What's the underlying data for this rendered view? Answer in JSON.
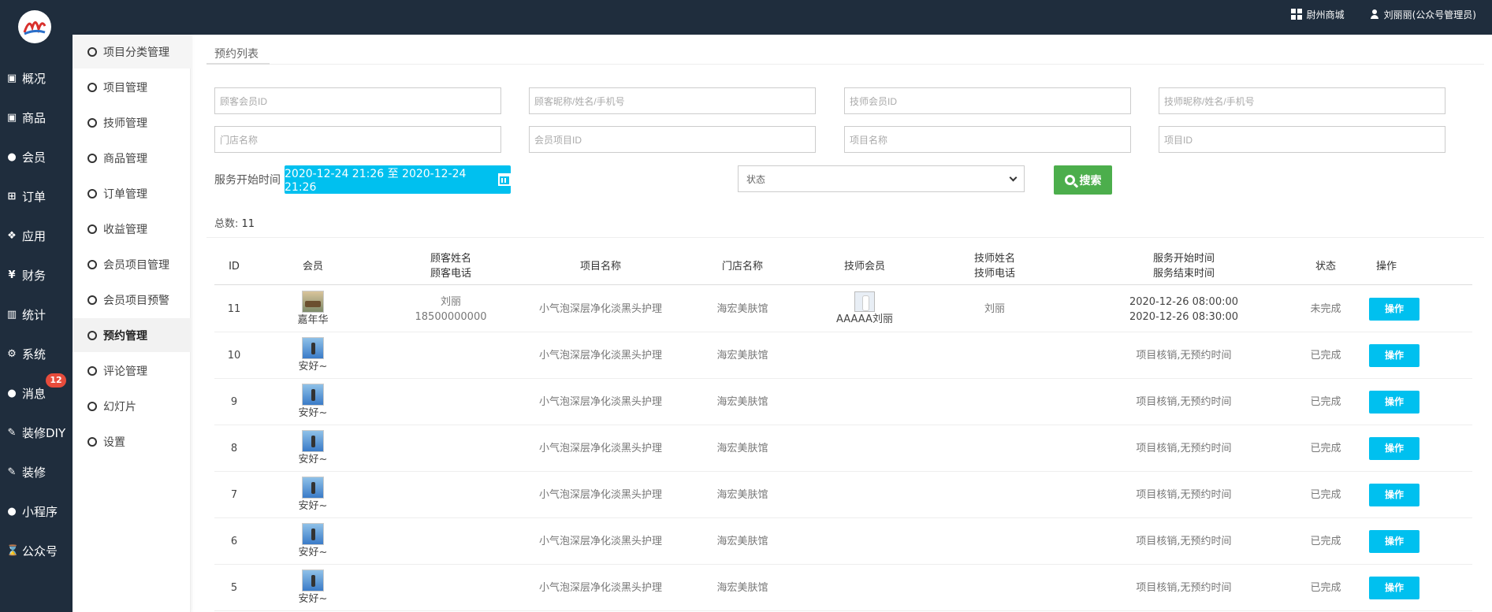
{
  "topbar": {
    "shop_label": "尉州商城",
    "user_label": "刘丽丽(公众号管理员)"
  },
  "sidebar": {
    "items": [
      {
        "label": "概况",
        "icon": "overview-icon",
        "glyph": "▣"
      },
      {
        "label": "商品",
        "icon": "goods-icon",
        "glyph": "▣"
      },
      {
        "label": "会员",
        "icon": "members-icon",
        "glyph": "●"
      },
      {
        "label": "订单",
        "icon": "cart-icon",
        "glyph": "⊞"
      },
      {
        "label": "应用",
        "icon": "apps-icon",
        "glyph": "❖"
      },
      {
        "label": "财务",
        "icon": "yen-icon",
        "glyph": "¥"
      },
      {
        "label": "统计",
        "icon": "chart-icon",
        "glyph": "▥"
      },
      {
        "label": "系统",
        "icon": "cogs-icon",
        "glyph": "⚙"
      },
      {
        "label": "消息",
        "icon": "comment-icon",
        "glyph": "●"
      },
      {
        "label": "装修DIY",
        "icon": "gavel-icon",
        "glyph": "✎"
      },
      {
        "label": "装修",
        "icon": "gavel-icon",
        "glyph": "✎"
      },
      {
        "label": "小程序",
        "icon": "wechat-icon",
        "glyph": "●"
      },
      {
        "label": "公众号",
        "icon": "hourglass-icon",
        "glyph": "⌛"
      }
    ],
    "message_badge": "12"
  },
  "submenu": {
    "items": [
      {
        "label": "项目分类管理"
      },
      {
        "label": "项目管理"
      },
      {
        "label": "技师管理"
      },
      {
        "label": "商品管理"
      },
      {
        "label": "订单管理"
      },
      {
        "label": "收益管理"
      },
      {
        "label": "会员项目管理"
      },
      {
        "label": "会员项目预警"
      },
      {
        "label": "预约管理"
      },
      {
        "label": "评论管理"
      },
      {
        "label": "幻灯片"
      },
      {
        "label": "设置"
      }
    ]
  },
  "page": {
    "title": "预约列表"
  },
  "filters": {
    "customer_member_id": "顾客会员ID",
    "customer_name": "顾客昵称/姓名/手机号",
    "tech_member_id": "技师会员ID",
    "tech_name": "技师昵称/姓名/手机号",
    "store_name": "门店名称",
    "member_project_id": "会员项目ID",
    "project_name": "项目名称",
    "project_id": "项目ID",
    "service_time_label": "服务开始时间",
    "date_range": "2020-12-24 21:26 至 2020-12-24 21:26",
    "status_placeholder": "状态",
    "search_label": "搜索"
  },
  "summary": {
    "total_label": "总数:",
    "total_value": "11"
  },
  "table": {
    "headers": {
      "id": "ID",
      "member": "会员",
      "customer_name": "顾客姓名",
      "customer_phone": "顾客电话",
      "project": "项目名称",
      "store": "门店名称",
      "tech_member": "技师会员",
      "tech_name": "技师姓名",
      "tech_phone": "技师电话",
      "start_time": "服务开始时间",
      "end_time": "服务结束时间",
      "status": "状态",
      "action": "操作"
    },
    "rows": [
      {
        "id": "11",
        "member": "嘉年华",
        "cust_name": "刘丽",
        "cust_phone": "18500000000",
        "project": "小气泡深层净化淡黑头护理",
        "store": "海宏美肤馆",
        "tech_member": "AAAAA刘丽",
        "tech_name": "刘丽",
        "time1": "2020-12-26 08:00:00",
        "time2": "2020-12-26 08:30:00",
        "status": "未完成",
        "action": "操作"
      },
      {
        "id": "10",
        "member": "安好~",
        "cust_name": "",
        "cust_phone": "",
        "project": "小气泡深层净化淡黑头护理",
        "store": "海宏美肤馆",
        "tech_member": "",
        "tech_name": "",
        "time1": "项目核销,无预约时间",
        "time2": "",
        "status": "已完成",
        "action": "操作"
      },
      {
        "id": "9",
        "member": "安好~",
        "cust_name": "",
        "cust_phone": "",
        "project": "小气泡深层净化淡黑头护理",
        "store": "海宏美肤馆",
        "tech_member": "",
        "tech_name": "",
        "time1": "项目核销,无预约时间",
        "time2": "",
        "status": "已完成",
        "action": "操作"
      },
      {
        "id": "8",
        "member": "安好~",
        "cust_name": "",
        "cust_phone": "",
        "project": "小气泡深层净化淡黑头护理",
        "store": "海宏美肤馆",
        "tech_member": "",
        "tech_name": "",
        "time1": "项目核销,无预约时间",
        "time2": "",
        "status": "已完成",
        "action": "操作"
      },
      {
        "id": "7",
        "member": "安好~",
        "cust_name": "",
        "cust_phone": "",
        "project": "小气泡深层净化淡黑头护理",
        "store": "海宏美肤馆",
        "tech_member": "",
        "tech_name": "",
        "time1": "项目核销,无预约时间",
        "time2": "",
        "status": "已完成",
        "action": "操作"
      },
      {
        "id": "6",
        "member": "安好~",
        "cust_name": "",
        "cust_phone": "",
        "project": "小气泡深层净化淡黑头护理",
        "store": "海宏美肤馆",
        "tech_member": "",
        "tech_name": "",
        "time1": "项目核销,无预约时间",
        "time2": "",
        "status": "已完成",
        "action": "操作"
      },
      {
        "id": "5",
        "member": "安好~",
        "cust_name": "",
        "cust_phone": "",
        "project": "小气泡深层净化淡黑头护理",
        "store": "海宏美肤馆",
        "tech_member": "",
        "tech_name": "",
        "time1": "项目核销,无预约时间",
        "time2": "",
        "status": "已完成",
        "action": "操作"
      }
    ]
  },
  "colors": {
    "sidebar_bg": "#1f2d3d",
    "accent": "#00c0ef",
    "search_green": "#4cae4c",
    "badge_red": "#e74c3c"
  }
}
